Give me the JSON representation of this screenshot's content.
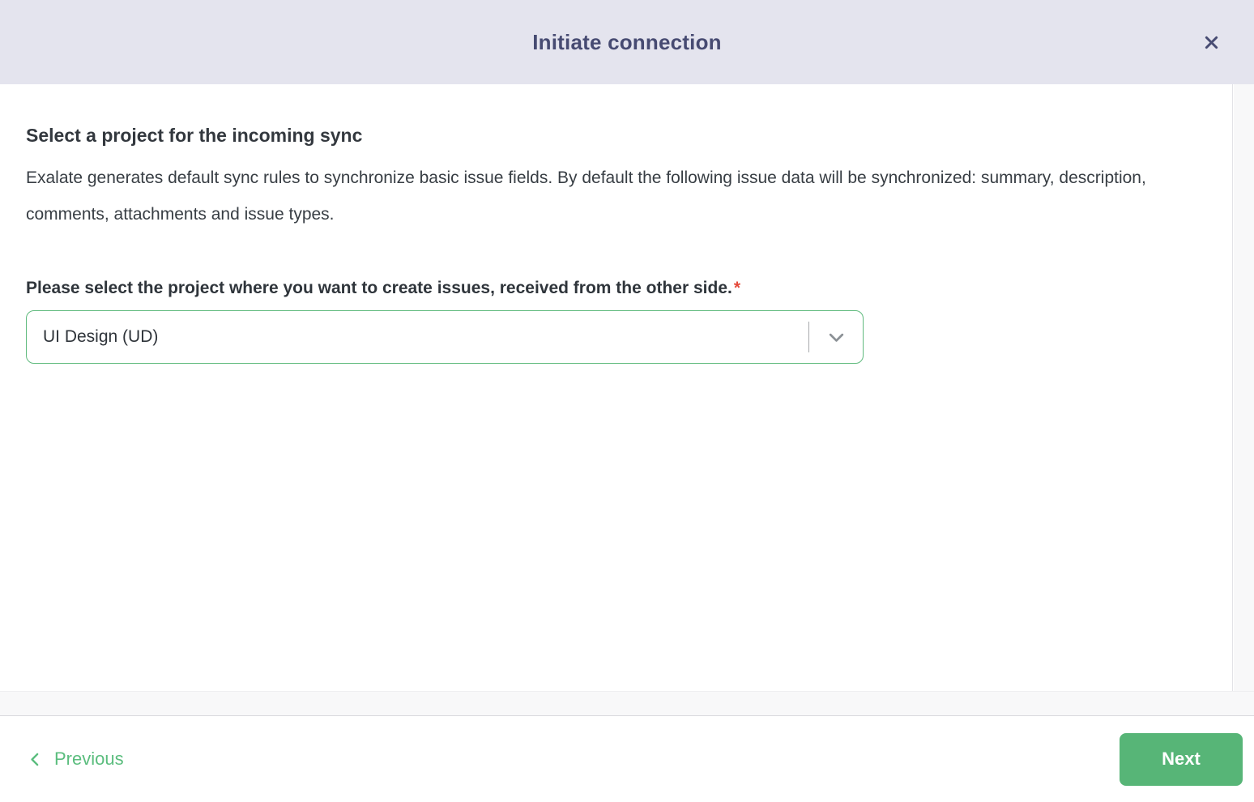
{
  "modal": {
    "title": "Initiate connection"
  },
  "content": {
    "heading": "Select a project for the incoming sync",
    "description": "Exalate generates default sync rules to synchronize basic issue fields. By default the following issue data will be synchronized: summary, description, comments, attachments and issue types.",
    "select_label": "Please select the project where you want to create issues, received from the other side.",
    "required_marker": "*",
    "project_select": {
      "value": "UI Design (UD)"
    }
  },
  "footer": {
    "previous_label": "Previous",
    "next_label": "Next"
  },
  "icons": {
    "close": "x-icon",
    "select": "chevron-down-icon",
    "previous": "chevron-left-icon"
  },
  "colors": {
    "header_bg": "#e4e4ee",
    "title_text": "#474b72",
    "body_text": "#383e44",
    "accent_green": "#57b577",
    "select_border": "#5fba7d",
    "required_red": "#e5493a"
  }
}
